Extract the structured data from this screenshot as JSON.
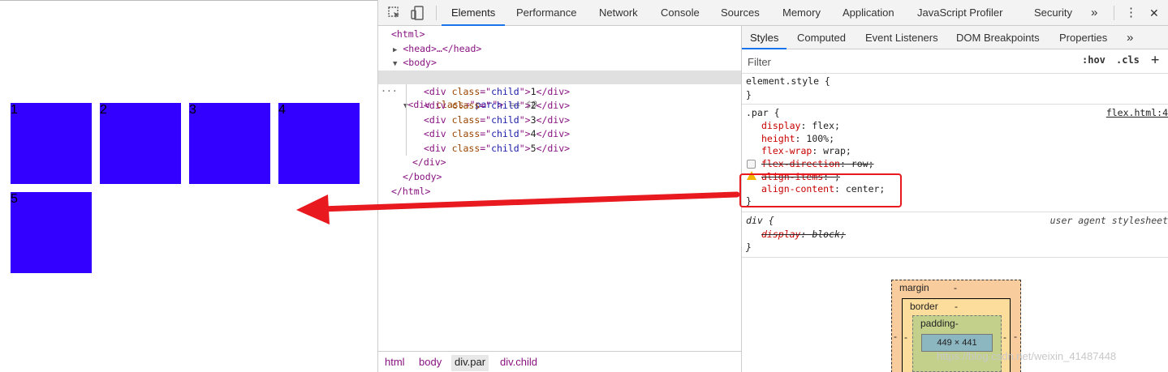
{
  "viewport": {
    "children": [
      "1",
      "2",
      "3",
      "4",
      "5"
    ],
    "box_color": "#3300ff"
  },
  "toolbar": {
    "icons": [
      "inspect-icon",
      "device-toolbar-icon"
    ],
    "tabs": [
      "Elements",
      "Performance",
      "Network",
      "Console",
      "Sources",
      "Memory",
      "Application",
      "JavaScript Profiler",
      "Security"
    ],
    "active_tab": "Elements",
    "overflow": "»",
    "menu": "⋮",
    "close": "✕"
  },
  "dom": {
    "html_open": "<html>",
    "head": "<head>…</head>",
    "body_open": "<body>",
    "div_par": {
      "tag": "div",
      "attr": "class",
      "value": "par",
      "marker": "== $0"
    },
    "children": [
      {
        "attr": "class",
        "value": "child",
        "text": "1"
      },
      {
        "attr": "class",
        "value": "child",
        "text": "2"
      },
      {
        "attr": "class",
        "value": "child",
        "text": "3"
      },
      {
        "attr": "class",
        "value": "child",
        "text": "4"
      },
      {
        "attr": "class",
        "value": "child",
        "text": "5"
      }
    ],
    "div_close": "</div>",
    "body_close": "</body>",
    "html_close": "</html>"
  },
  "breadcrumbs": [
    "html",
    "body",
    "div.par",
    "div.child"
  ],
  "sidebar": {
    "tabs": [
      "Styles",
      "Computed",
      "Event Listeners",
      "DOM Breakpoints",
      "Properties"
    ],
    "active_tab": "Styles",
    "overflow": "»",
    "filter_placeholder": "Filter",
    "hov": ":hov",
    "cls": ".cls",
    "plus": "+"
  },
  "styles": {
    "element_style": {
      "selector": "element.style {",
      "close": "}"
    },
    "par_rule": {
      "selector": ".par {",
      "source": "flex.html:4",
      "props": [
        {
          "name": "display",
          "value": "flex;"
        },
        {
          "name": "height",
          "value": "100%;"
        },
        {
          "name": "flex-wrap",
          "value": "wrap;"
        },
        {
          "name": "flex-direction",
          "value": "row;"
        },
        {
          "name": "align-items",
          "value": ";"
        },
        {
          "name": "align-content",
          "value": "center;"
        }
      ],
      "close": "}"
    },
    "ua_rule": {
      "selector": "div {",
      "source": "user agent stylesheet",
      "props": [
        {
          "name": "display",
          "value": "block;"
        }
      ],
      "close": "}"
    }
  },
  "box_model": {
    "margin": "margin",
    "border": "border",
    "padding": "padding-",
    "content": "449 × 441",
    "dash": "-"
  },
  "annotation": {
    "highlight_color": "#e8191f",
    "arrow_color": "#e8191f"
  },
  "watermark": "https://blog.csdn.net/weixin_41487448"
}
